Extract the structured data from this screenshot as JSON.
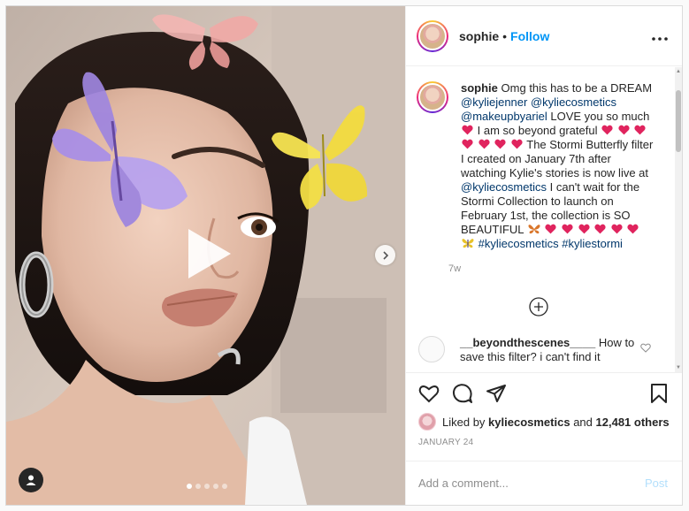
{
  "post": {
    "username": "sophie",
    "separator": "•",
    "follow_label": "Follow",
    "more_icon": "more-horizontal-icon"
  },
  "caption": {
    "username": "sophie",
    "text_1": "Omg this has to be a DREAM",
    "mention_1": "@kyliejenner",
    "mention_2": "@kyliecosmetics",
    "mention_3": "@makeupbyariel",
    "text_2": "LOVE you so much",
    "text_3": "I am so beyond grateful",
    "text_4": "The Stormi Butterfly filter I created on January 7th after watching Kylie's stories is now live at",
    "mention_4": "@kyliecosmetics",
    "text_5": "I can't wait for the Stormi Collection to launch on February 1st, the collection is SO BEAUTIFUL",
    "hashtag_1": "#kyliecosmetics",
    "hashtag_2": "#kyliestormi",
    "time": "7w"
  },
  "comments": [
    {
      "username": "__beyondthescenes____",
      "text": "How to save this filter? i can't find it"
    }
  ],
  "likes": {
    "prefix": "Liked by",
    "user": "kyliecosmetics",
    "middle": "and",
    "count": "12,481 others"
  },
  "date": "JANUARY 24",
  "add_comment": {
    "placeholder": "Add a comment...",
    "post_label": "Post"
  },
  "media": {
    "carousel_count": 5,
    "carousel_active": 1
  },
  "colors": {
    "link": "#00376b",
    "follow": "#0095f6",
    "heart": "#e0245e",
    "muted": "#8e8e8e"
  }
}
